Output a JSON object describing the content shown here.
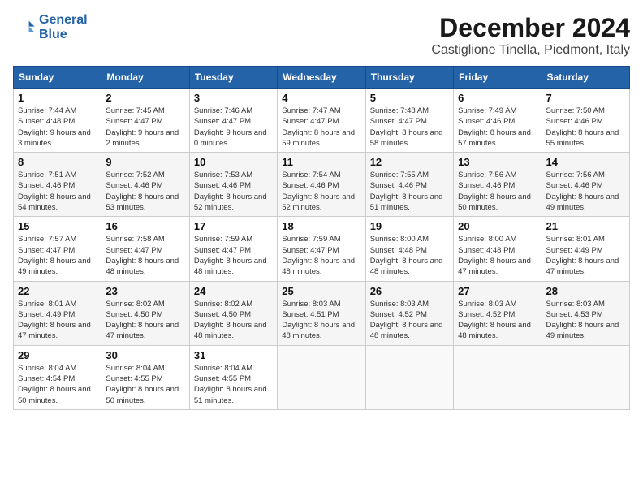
{
  "header": {
    "logo_line1": "General",
    "logo_line2": "Blue",
    "month_title": "December 2024",
    "location": "Castiglione Tinella, Piedmont, Italy"
  },
  "weekdays": [
    "Sunday",
    "Monday",
    "Tuesday",
    "Wednesday",
    "Thursday",
    "Friday",
    "Saturday"
  ],
  "weeks": [
    [
      {
        "day": "1",
        "sunrise": "Sunrise: 7:44 AM",
        "sunset": "Sunset: 4:48 PM",
        "daylight": "Daylight: 9 hours and 3 minutes."
      },
      {
        "day": "2",
        "sunrise": "Sunrise: 7:45 AM",
        "sunset": "Sunset: 4:47 PM",
        "daylight": "Daylight: 9 hours and 2 minutes."
      },
      {
        "day": "3",
        "sunrise": "Sunrise: 7:46 AM",
        "sunset": "Sunset: 4:47 PM",
        "daylight": "Daylight: 9 hours and 0 minutes."
      },
      {
        "day": "4",
        "sunrise": "Sunrise: 7:47 AM",
        "sunset": "Sunset: 4:47 PM",
        "daylight": "Daylight: 8 hours and 59 minutes."
      },
      {
        "day": "5",
        "sunrise": "Sunrise: 7:48 AM",
        "sunset": "Sunset: 4:47 PM",
        "daylight": "Daylight: 8 hours and 58 minutes."
      },
      {
        "day": "6",
        "sunrise": "Sunrise: 7:49 AM",
        "sunset": "Sunset: 4:46 PM",
        "daylight": "Daylight: 8 hours and 57 minutes."
      },
      {
        "day": "7",
        "sunrise": "Sunrise: 7:50 AM",
        "sunset": "Sunset: 4:46 PM",
        "daylight": "Daylight: 8 hours and 55 minutes."
      }
    ],
    [
      {
        "day": "8",
        "sunrise": "Sunrise: 7:51 AM",
        "sunset": "Sunset: 4:46 PM",
        "daylight": "Daylight: 8 hours and 54 minutes."
      },
      {
        "day": "9",
        "sunrise": "Sunrise: 7:52 AM",
        "sunset": "Sunset: 4:46 PM",
        "daylight": "Daylight: 8 hours and 53 minutes."
      },
      {
        "day": "10",
        "sunrise": "Sunrise: 7:53 AM",
        "sunset": "Sunset: 4:46 PM",
        "daylight": "Daylight: 8 hours and 52 minutes."
      },
      {
        "day": "11",
        "sunrise": "Sunrise: 7:54 AM",
        "sunset": "Sunset: 4:46 PM",
        "daylight": "Daylight: 8 hours and 52 minutes."
      },
      {
        "day": "12",
        "sunrise": "Sunrise: 7:55 AM",
        "sunset": "Sunset: 4:46 PM",
        "daylight": "Daylight: 8 hours and 51 minutes."
      },
      {
        "day": "13",
        "sunrise": "Sunrise: 7:56 AM",
        "sunset": "Sunset: 4:46 PM",
        "daylight": "Daylight: 8 hours and 50 minutes."
      },
      {
        "day": "14",
        "sunrise": "Sunrise: 7:56 AM",
        "sunset": "Sunset: 4:46 PM",
        "daylight": "Daylight: 8 hours and 49 minutes."
      }
    ],
    [
      {
        "day": "15",
        "sunrise": "Sunrise: 7:57 AM",
        "sunset": "Sunset: 4:47 PM",
        "daylight": "Daylight: 8 hours and 49 minutes."
      },
      {
        "day": "16",
        "sunrise": "Sunrise: 7:58 AM",
        "sunset": "Sunset: 4:47 PM",
        "daylight": "Daylight: 8 hours and 48 minutes."
      },
      {
        "day": "17",
        "sunrise": "Sunrise: 7:59 AM",
        "sunset": "Sunset: 4:47 PM",
        "daylight": "Daylight: 8 hours and 48 minutes."
      },
      {
        "day": "18",
        "sunrise": "Sunrise: 7:59 AM",
        "sunset": "Sunset: 4:47 PM",
        "daylight": "Daylight: 8 hours and 48 minutes."
      },
      {
        "day": "19",
        "sunrise": "Sunrise: 8:00 AM",
        "sunset": "Sunset: 4:48 PM",
        "daylight": "Daylight: 8 hours and 48 minutes."
      },
      {
        "day": "20",
        "sunrise": "Sunrise: 8:00 AM",
        "sunset": "Sunset: 4:48 PM",
        "daylight": "Daylight: 8 hours and 47 minutes."
      },
      {
        "day": "21",
        "sunrise": "Sunrise: 8:01 AM",
        "sunset": "Sunset: 4:49 PM",
        "daylight": "Daylight: 8 hours and 47 minutes."
      }
    ],
    [
      {
        "day": "22",
        "sunrise": "Sunrise: 8:01 AM",
        "sunset": "Sunset: 4:49 PM",
        "daylight": "Daylight: 8 hours and 47 minutes."
      },
      {
        "day": "23",
        "sunrise": "Sunrise: 8:02 AM",
        "sunset": "Sunset: 4:50 PM",
        "daylight": "Daylight: 8 hours and 47 minutes."
      },
      {
        "day": "24",
        "sunrise": "Sunrise: 8:02 AM",
        "sunset": "Sunset: 4:50 PM",
        "daylight": "Daylight: 8 hours and 48 minutes."
      },
      {
        "day": "25",
        "sunrise": "Sunrise: 8:03 AM",
        "sunset": "Sunset: 4:51 PM",
        "daylight": "Daylight: 8 hours and 48 minutes."
      },
      {
        "day": "26",
        "sunrise": "Sunrise: 8:03 AM",
        "sunset": "Sunset: 4:52 PM",
        "daylight": "Daylight: 8 hours and 48 minutes."
      },
      {
        "day": "27",
        "sunrise": "Sunrise: 8:03 AM",
        "sunset": "Sunset: 4:52 PM",
        "daylight": "Daylight: 8 hours and 48 minutes."
      },
      {
        "day": "28",
        "sunrise": "Sunrise: 8:03 AM",
        "sunset": "Sunset: 4:53 PM",
        "daylight": "Daylight: 8 hours and 49 minutes."
      }
    ],
    [
      {
        "day": "29",
        "sunrise": "Sunrise: 8:04 AM",
        "sunset": "Sunset: 4:54 PM",
        "daylight": "Daylight: 8 hours and 50 minutes."
      },
      {
        "day": "30",
        "sunrise": "Sunrise: 8:04 AM",
        "sunset": "Sunset: 4:55 PM",
        "daylight": "Daylight: 8 hours and 50 minutes."
      },
      {
        "day": "31",
        "sunrise": "Sunrise: 8:04 AM",
        "sunset": "Sunset: 4:55 PM",
        "daylight": "Daylight: 8 hours and 51 minutes."
      },
      null,
      null,
      null,
      null
    ]
  ]
}
